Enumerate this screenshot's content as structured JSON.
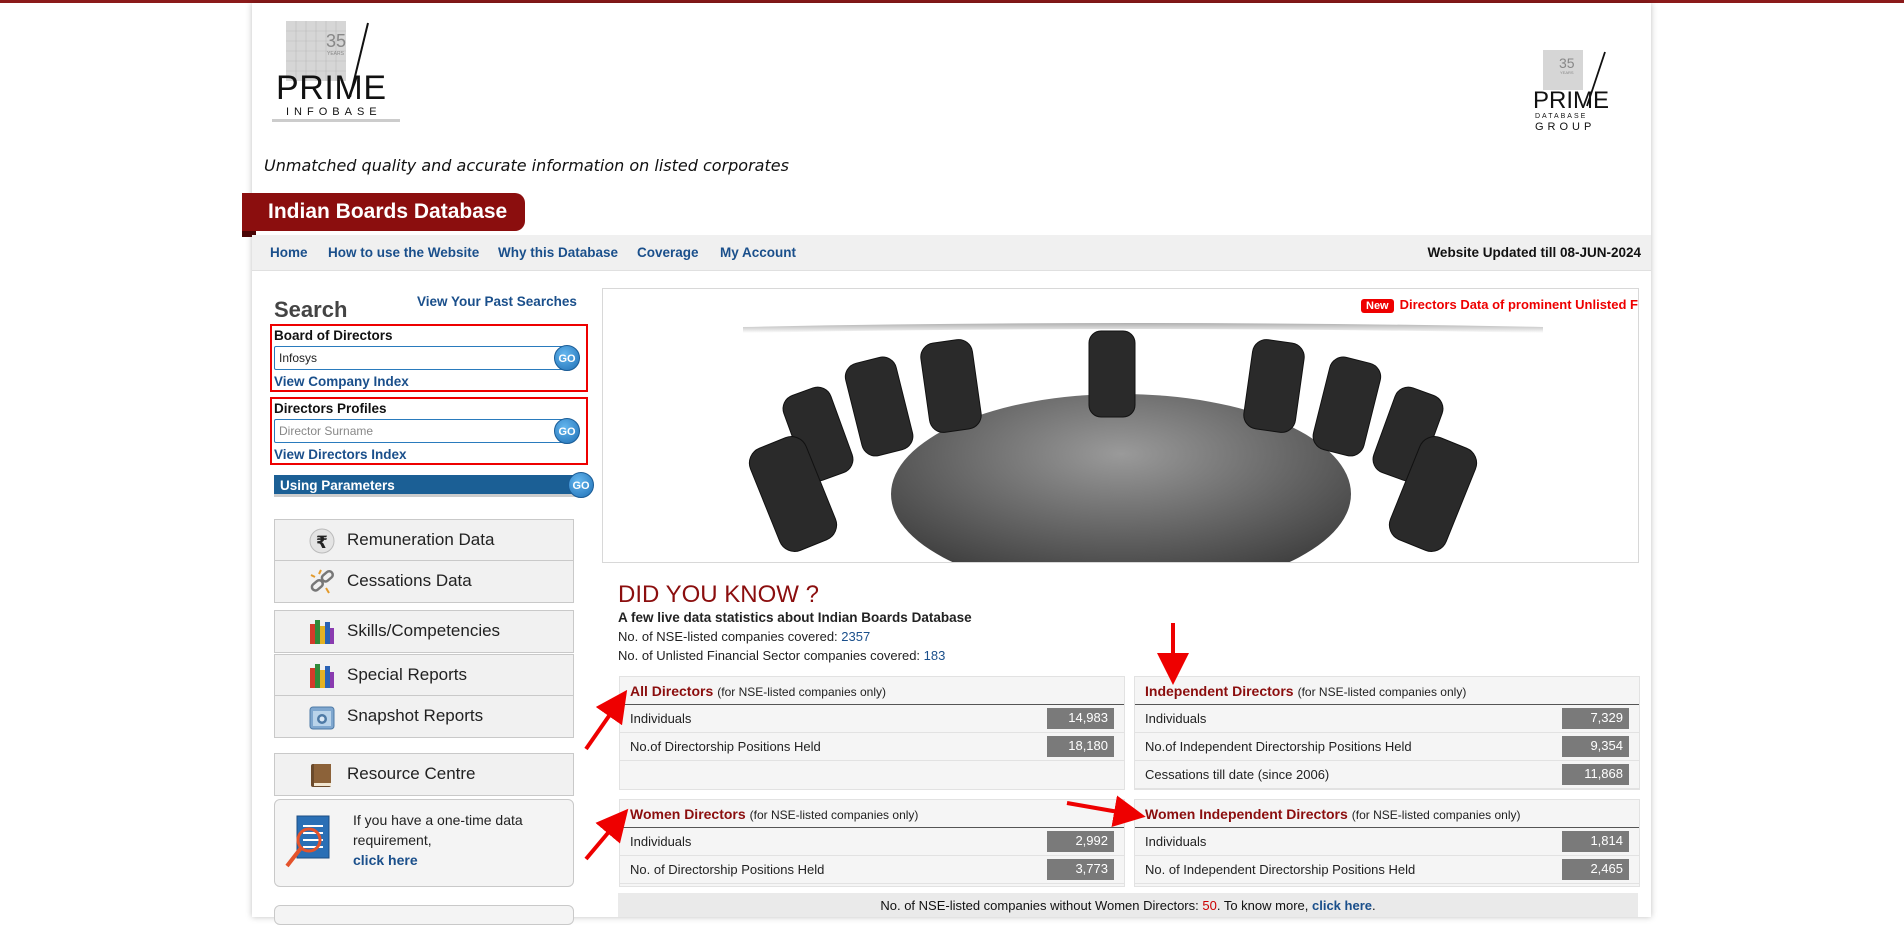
{
  "brand": {
    "logo_left_text": "PRIME",
    "logo_left_sub": "INFOBASE",
    "logo_left_years": "35",
    "logo_left_years_word": "YEARS",
    "logo_right_text": "PRIME",
    "logo_right_sub": "DATABASE",
    "logo_right_sub2": "GROUP",
    "logo_right_years": "35",
    "logo_right_years_word": "YEARS",
    "tagline": "Unmatched quality and accurate information on listed corporates",
    "title": "Indian Boards Database"
  },
  "nav": {
    "items": [
      "Home",
      "How to use the Website",
      "Why this Database",
      "Coverage",
      "My Account"
    ],
    "updated": "Website Updated till 08-JUN-2024"
  },
  "sidebar": {
    "search_title": "Search",
    "past_searches": "View Your Past Searches",
    "board": {
      "label": "Board of Directors",
      "value": "Infosys",
      "go": "GO",
      "link": "View Company Index"
    },
    "profiles": {
      "label": "Directors Profiles",
      "placeholder": "Director Surname",
      "go": "GO",
      "link": "View Directors Index"
    },
    "callout": "1",
    "parameters": {
      "label": "Using Parameters",
      "go": "GO"
    },
    "menu": [
      {
        "label": "Remuneration Data",
        "icon": "rupee-icon"
      },
      {
        "label": "Cessations Data",
        "icon": "broken-chain-icon"
      },
      {
        "label": "Skills/Competencies",
        "icon": "books-icon"
      },
      {
        "label": "Special Reports",
        "icon": "books-icon"
      },
      {
        "label": "Snapshot Reports",
        "icon": "camera-icon"
      },
      {
        "label": "Resource Centre",
        "icon": "book-icon"
      }
    ],
    "help": {
      "text": "If you have a one-time data requirement,",
      "link": "click here"
    }
  },
  "banner": {
    "badge": "New",
    "ticker": "Directors Data of prominent Unlisted F"
  },
  "did_you_know": {
    "title": "DID YOU KNOW ?",
    "subtitle": "A few live data statistics about Indian Boards Database",
    "nse_label": "No. of NSE-listed companies covered:",
    "nse_value": "2357",
    "unlisted_label": "No. of Unlisted Financial Sector companies covered:",
    "unlisted_value": "183"
  },
  "stats": {
    "all": {
      "title": "All Directors",
      "note": "(for NSE-listed companies only)",
      "rows": [
        {
          "label": "Individuals",
          "value": "14,983"
        },
        {
          "label": "No.of Directorship Positions Held",
          "value": "18,180"
        }
      ]
    },
    "independent": {
      "title": "Independent Directors",
      "note": "(for NSE-listed companies only)",
      "rows": [
        {
          "label": "Individuals",
          "value": "7,329"
        },
        {
          "label": "No.of Independent Directorship Positions Held",
          "value": "9,354"
        },
        {
          "label": "Cessations till date (since 2006)",
          "value": "11,868"
        }
      ]
    },
    "women": {
      "title": "Women Directors",
      "note": "(for NSE-listed companies only)",
      "rows": [
        {
          "label": "Individuals",
          "value": "2,992"
        },
        {
          "label": "No. of Directorship Positions Held",
          "value": "3,773"
        }
      ]
    },
    "women_independent": {
      "title": "Women Independent Directors",
      "note": "(for NSE-listed companies only)",
      "rows": [
        {
          "label": "Individuals",
          "value": "1,814"
        },
        {
          "label": "No. of Independent Directorship Positions Held",
          "value": "2,465"
        }
      ]
    }
  },
  "footer": {
    "text": "No. of NSE-listed companies without Women Directors:",
    "value": "50",
    "tail": ". To know more,",
    "link": "click here",
    "end": "."
  },
  "colors": {
    "brand_red": "#8b0e0e",
    "link_blue": "#1a4f8b",
    "alert_red": "#e00000"
  }
}
